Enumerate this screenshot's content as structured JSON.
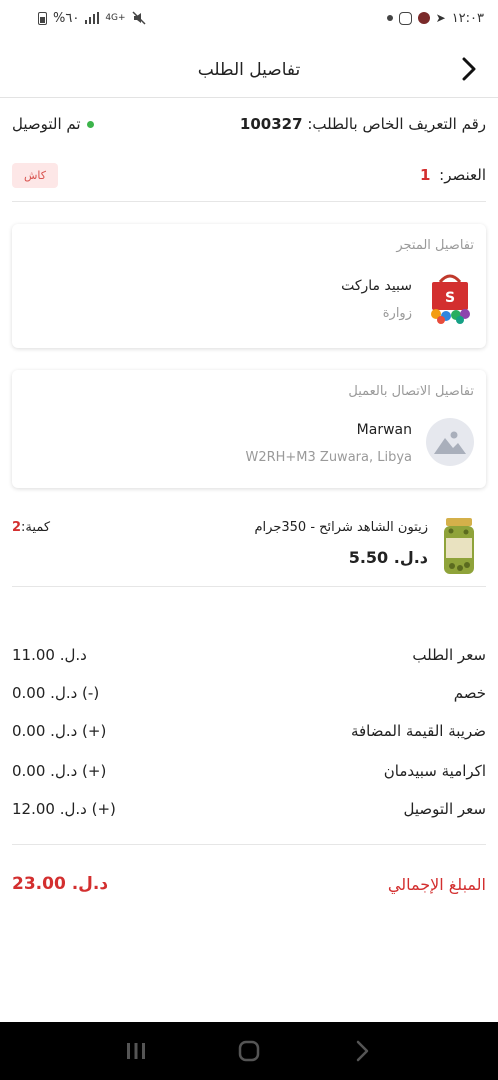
{
  "status_bar": {
    "time": "١٢:٠٣",
    "battery": "%٦٠",
    "network": "4G+"
  },
  "header": {
    "title": "تفاصيل الطلب",
    "back_icon": "chevron-right-icon"
  },
  "order": {
    "id_label": "رقم التعريف الخاص بالطلب:",
    "id_value": "100327",
    "status": "تم التوصيل",
    "status_color": "#3cb44b",
    "items_label": "العنصر:",
    "items_count": "1",
    "payment_badge": "كاش"
  },
  "store": {
    "section_title": "تفاصيل المتجر",
    "name": "سبيد ماركت",
    "city": "زوارة"
  },
  "customer": {
    "section_title": "تفاصيل الاتصال بالعميل",
    "name": "Marwan",
    "address": "W2RH+M3 Zuwara, Libya"
  },
  "product": {
    "name": "زيتون الشاهد شرائح - 350جرام",
    "price": "د.ل. 5.50",
    "qty_label": "كمية:",
    "qty_value": "2"
  },
  "summary": [
    {
      "label": "سعر الطلب",
      "value": "د.ل. 11.00"
    },
    {
      "label": "خصم",
      "value": "(-) د.ل. 0.00"
    },
    {
      "label": "ضريبة القيمة المضافة",
      "value": "(+) د.ل. 0.00"
    },
    {
      "label": "اكرامية سبيدمان",
      "value": "(+) د.ل. 0.00"
    },
    {
      "label": "سعر التوصيل",
      "value": "(+) د.ل. 12.00"
    }
  ],
  "total": {
    "label": "المبلغ الإجمالي",
    "value": "د.ل. 23.00",
    "color": "#d32f2f"
  }
}
